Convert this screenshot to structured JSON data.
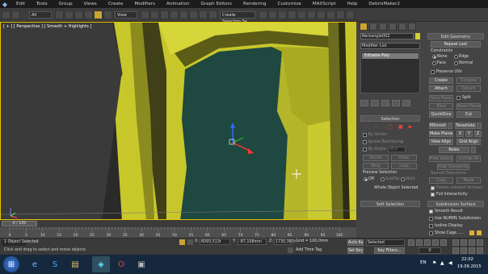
{
  "menu": [
    "Edit",
    "Tools",
    "Group",
    "Views",
    "Create",
    "Modifiers",
    "Animation",
    "Graph Editors",
    "Rendering",
    "Customize",
    "MAXScript",
    "Help",
    "DebrisMaker2"
  ],
  "toolbar": {
    "filter": "All",
    "view": "View",
    "selection_set": "Create Selection Se"
  },
  "viewport": {
    "label": "[ + ] [ Perspective ] [ Smooth + Highlights ]",
    "frame_counter": "0 / 100",
    "bg": "#cbcb2c",
    "opening": "#1e4640"
  },
  "command_panel": {
    "object_name": "Rectangle002",
    "modifier_list": "Modifier List",
    "stack_item": "Editable Poly",
    "selection": {
      "title": "Selection",
      "by_vertex": "By Vertex",
      "ignore_backfacing": "Ignore Backfacing",
      "by_angle": "By Angle:",
      "angle_value": "45,0",
      "shrink": "Shrink",
      "grow": "Grow",
      "ring": "Ring",
      "loop": "Loop",
      "preview_title": "Preview Selection",
      "off": "Off",
      "subobj": "SubObj",
      "multi": "Multi",
      "whole_object": "Whole Object Selected"
    },
    "soft_selection": "Soft Selection",
    "edit_geometry": {
      "title": "Edit Geometry",
      "repeat_last": "Repeat Last",
      "constraints": "Constraints",
      "none": "None",
      "edge": "Edge",
      "face": "Face",
      "normal": "Normal",
      "preserve_uvs": "Preserve UVs",
      "create": "Create",
      "collapse": "Collapse",
      "attach": "Attach",
      "detach": "Detach",
      "slice_plane": "Slice Plane",
      "split": "Split",
      "slice": "Slice",
      "reset_plane": "Reset Plane",
      "quickslice": "QuickSlice",
      "cut": "Cut",
      "msmooth": "MSmooth",
      "tessellate": "Tessellate",
      "make_planar": "Make Planar",
      "x": "X",
      "y": "Y",
      "z": "Z",
      "view_align": "View Align",
      "grid_align": "Grid Align",
      "relax": "Relax",
      "hide_selected": "Hide Selected",
      "unhide_all": "Unhide All",
      "hide_unselected": "Hide Unselected",
      "named_selections": "Named Selections:",
      "copy": "Copy",
      "paste": "Paste",
      "delete_isolated": "Delete Isolated Vertices",
      "full_interactivity": "Full Interactivity"
    },
    "subdivision": {
      "title": "Subdivision Surface",
      "smooth_result": "Smooth Result",
      "use_nurms": "Use NURMS Subdivision",
      "isoline": "Isoline Display",
      "show_cage": "Show Cage......"
    }
  },
  "timeline": {
    "ticks": [
      "0",
      "5",
      "10",
      "15",
      "20",
      "25",
      "30",
      "35",
      "40",
      "45",
      "50",
      "55",
      "60",
      "65",
      "70",
      "75",
      "80",
      "85",
      "90",
      "95",
      "100"
    ]
  },
  "status": {
    "objects": "1 Object Selected",
    "prompt": "Click and drag to select and move objects",
    "x": "6093,513r",
    "y": "-87,108mm",
    "z": "1730,387r",
    "grid": "Grid = 100,0mm",
    "auto_key": "Auto Key",
    "set_key": "Set Key",
    "selected": "Selected",
    "key_filters": "Key Filters...",
    "add_time_tag": "Add Time Tag",
    "frame": "0"
  },
  "taskbar": {
    "lang": "EN",
    "time": "22:02",
    "date": "19.09.2015"
  }
}
